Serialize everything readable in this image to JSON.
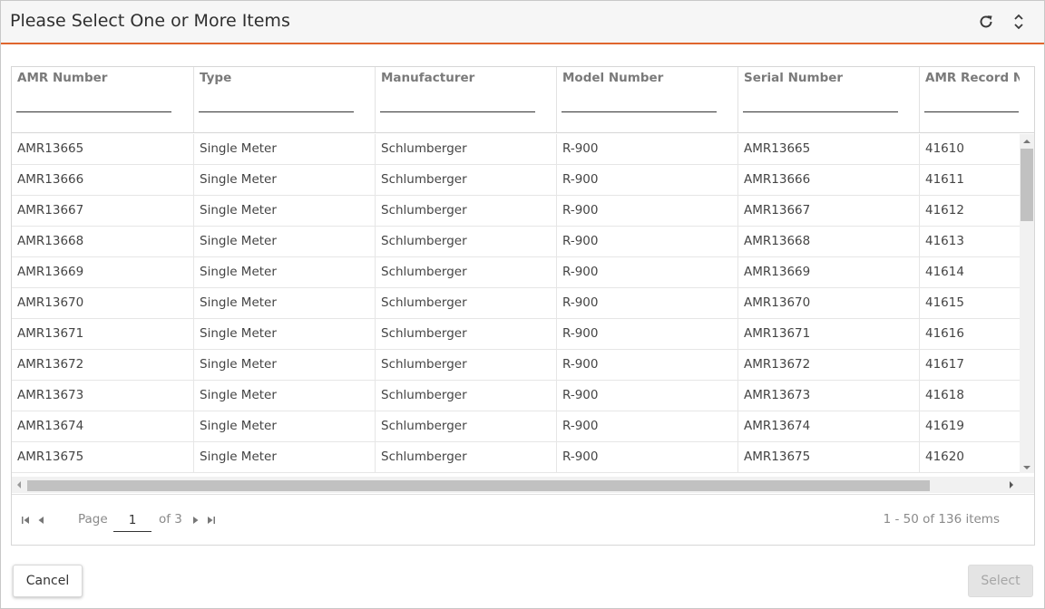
{
  "dialog": {
    "title": "Please Select One or More Items",
    "icons": {
      "refresh": "refresh-icon",
      "toggle": "chevron-up-down-icon"
    }
  },
  "grid": {
    "columns": [
      "AMR Number",
      "Type",
      "Manufacturer",
      "Model Number",
      "Serial Number",
      "AMR Record Nu"
    ],
    "rows": [
      [
        "AMR13665",
        "Single Meter",
        "Schlumberger",
        "R-900",
        "AMR13665",
        "41610"
      ],
      [
        "AMR13666",
        "Single Meter",
        "Schlumberger",
        "R-900",
        "AMR13666",
        "41611"
      ],
      [
        "AMR13667",
        "Single Meter",
        "Schlumberger",
        "R-900",
        "AMR13667",
        "41612"
      ],
      [
        "AMR13668",
        "Single Meter",
        "Schlumberger",
        "R-900",
        "AMR13668",
        "41613"
      ],
      [
        "AMR13669",
        "Single Meter",
        "Schlumberger",
        "R-900",
        "AMR13669",
        "41614"
      ],
      [
        "AMR13670",
        "Single Meter",
        "Schlumberger",
        "R-900",
        "AMR13670",
        "41615"
      ],
      [
        "AMR13671",
        "Single Meter",
        "Schlumberger",
        "R-900",
        "AMR13671",
        "41616"
      ],
      [
        "AMR13672",
        "Single Meter",
        "Schlumberger",
        "R-900",
        "AMR13672",
        "41617"
      ],
      [
        "AMR13673",
        "Single Meter",
        "Schlumberger",
        "R-900",
        "AMR13673",
        "41618"
      ],
      [
        "AMR13674",
        "Single Meter",
        "Schlumberger",
        "R-900",
        "AMR13674",
        "41619"
      ],
      [
        "AMR13675",
        "Single Meter",
        "Schlumberger",
        "R-900",
        "AMR13675",
        "41620"
      ]
    ]
  },
  "pager": {
    "page_label": "Page",
    "page_value": "1",
    "of_label": "of 3",
    "items_info": "1 - 50 of 136 items"
  },
  "footer": {
    "cancel_label": "Cancel",
    "select_label": "Select"
  },
  "colors": {
    "accent": "#e0662d",
    "disabled_bg": "#e4e4e4",
    "disabled_text": "#a6a6a6"
  }
}
